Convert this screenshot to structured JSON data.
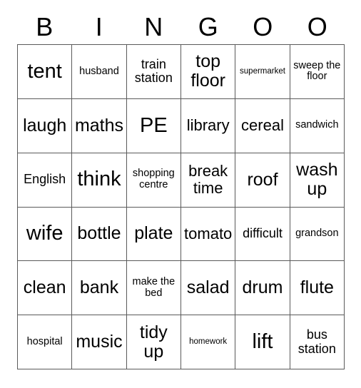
{
  "card": {
    "title_letters": [
      "B",
      "I",
      "N",
      "G",
      "O",
      "O"
    ],
    "rows": [
      [
        {
          "text": "tent",
          "size": "s-xl"
        },
        {
          "text": "husband",
          "size": "s-xs"
        },
        {
          "text": "train station",
          "size": "s-sm"
        },
        {
          "text": "top floor",
          "size": "s-lg"
        },
        {
          "text": "supermarket",
          "size": "s-xxs"
        },
        {
          "text": "sweep the floor",
          "size": "s-xs"
        }
      ],
      [
        {
          "text": "laugh",
          "size": "s-lg"
        },
        {
          "text": "maths",
          "size": "s-lg"
        },
        {
          "text": "PE",
          "size": "s-xl"
        },
        {
          "text": "library",
          "size": "s-md"
        },
        {
          "text": "cereal",
          "size": "s-md"
        },
        {
          "text": "sandwich",
          "size": "s-xs"
        }
      ],
      [
        {
          "text": "English",
          "size": "s-sm"
        },
        {
          "text": "think",
          "size": "s-xl"
        },
        {
          "text": "shopping centre",
          "size": "s-xs"
        },
        {
          "text": "break time",
          "size": "s-md"
        },
        {
          "text": "roof",
          "size": "s-lg"
        },
        {
          "text": "wash up",
          "size": "s-lg"
        }
      ],
      [
        {
          "text": "wife",
          "size": "s-xl"
        },
        {
          "text": "bottle",
          "size": "s-lg"
        },
        {
          "text": "plate",
          "size": "s-lg"
        },
        {
          "text": "tomato",
          "size": "s-md"
        },
        {
          "text": "difficult",
          "size": "s-sm"
        },
        {
          "text": "grandson",
          "size": "s-xs"
        }
      ],
      [
        {
          "text": "clean",
          "size": "s-lg"
        },
        {
          "text": "bank",
          "size": "s-lg"
        },
        {
          "text": "make the bed",
          "size": "s-xs"
        },
        {
          "text": "salad",
          "size": "s-lg"
        },
        {
          "text": "drum",
          "size": "s-lg"
        },
        {
          "text": "flute",
          "size": "s-lg"
        }
      ],
      [
        {
          "text": "hospital",
          "size": "s-xs"
        },
        {
          "text": "music",
          "size": "s-lg"
        },
        {
          "text": "tidy up",
          "size": "s-lg"
        },
        {
          "text": "homework",
          "size": "s-xxs"
        },
        {
          "text": "lift",
          "size": "s-xl"
        },
        {
          "text": "bus station",
          "size": "s-sm"
        }
      ]
    ]
  },
  "colors": {
    "border": "#5a5a5a",
    "text": "#000000",
    "background": "#ffffff"
  }
}
